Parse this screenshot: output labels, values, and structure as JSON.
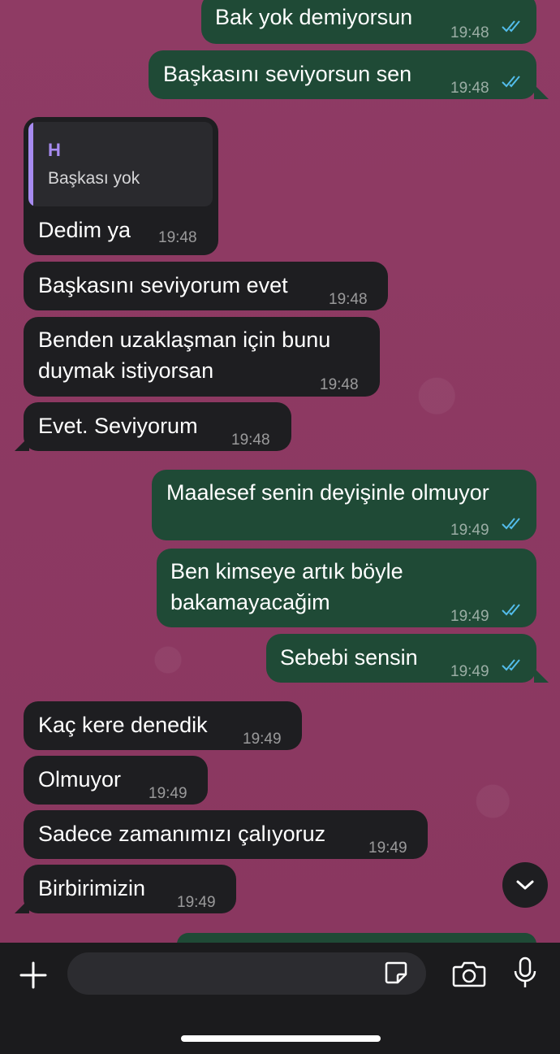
{
  "messages": [
    {
      "id": "m1",
      "dir": "out",
      "text": "Bak yok demiyorsun",
      "time": "19:48"
    },
    {
      "id": "m2",
      "dir": "out",
      "text": "Başkasını seviyorsun sen",
      "time": "19:48"
    },
    {
      "id": "m3",
      "dir": "in",
      "reply_name": "H",
      "reply_text": "Başkası yok",
      "text": "Dedim ya",
      "time": "19:48"
    },
    {
      "id": "m4",
      "dir": "in",
      "text": "Başkasını seviyorum evet",
      "time": "19:48"
    },
    {
      "id": "m5",
      "dir": "in",
      "line1": "Benden uzaklaşman için bunu",
      "line2": "duymak istiyorsan",
      "time": "19:48"
    },
    {
      "id": "m6",
      "dir": "in",
      "text": "Evet. Seviyorum",
      "time": "19:48"
    },
    {
      "id": "m7",
      "dir": "out",
      "text": "Maalesef senin deyişinle olmuyor",
      "time": "19:49"
    },
    {
      "id": "m8",
      "dir": "out",
      "line1": "Ben kimseye artık böyle",
      "line2": "bakamayacağim",
      "time": "19:49"
    },
    {
      "id": "m9",
      "dir": "out",
      "text": "Sebebi sensin",
      "time": "19:49"
    },
    {
      "id": "m10",
      "dir": "in",
      "text": "Kaç kere denedik",
      "time": "19:49"
    },
    {
      "id": "m11",
      "dir": "in",
      "text": "Olmuyor",
      "time": "19:49"
    },
    {
      "id": "m12",
      "dir": "in",
      "text": "Sadece zamanımızı çalıyoruz",
      "time": "19:49"
    },
    {
      "id": "m13",
      "dir": "in",
      "text": "Birbirimizin",
      "time": "19:49"
    }
  ],
  "icons": {
    "add": "plus-icon",
    "sticker": "sticker-icon",
    "camera": "camera-icon",
    "mic": "microphone-icon",
    "scroll": "chevron-down-icon",
    "read": "double-check-icon"
  },
  "colors": {
    "wallpaper": "#8e3a63",
    "outgoing": "#1f4a36",
    "incoming": "#1e1e21",
    "read_ticks": "#53bdeb",
    "reply_accent": "#a78bf0"
  },
  "composer": {
    "placeholder": ""
  }
}
